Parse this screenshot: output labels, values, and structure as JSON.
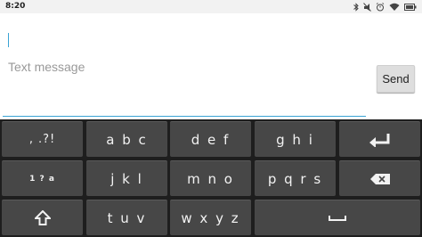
{
  "status_bar": {
    "time": "8:20",
    "icons": [
      "bluetooth-icon",
      "mute-icon",
      "alarm-icon",
      "wifi-icon",
      "battery-icon"
    ]
  },
  "compose": {
    "placeholder": "Text message",
    "value": "",
    "send_label": "Send",
    "accent_color": "#3aa3d4"
  },
  "keyboard": {
    "rows": [
      [
        "‚ .?!",
        "a b c",
        "d e f",
        "g h i",
        "enter-icon"
      ],
      [
        "1 ? a",
        "j k l",
        "m n o",
        "p q r s",
        "backspace-icon"
      ],
      [
        "shift-icon",
        "t u v",
        "w x y z",
        "space-icon"
      ]
    ]
  }
}
